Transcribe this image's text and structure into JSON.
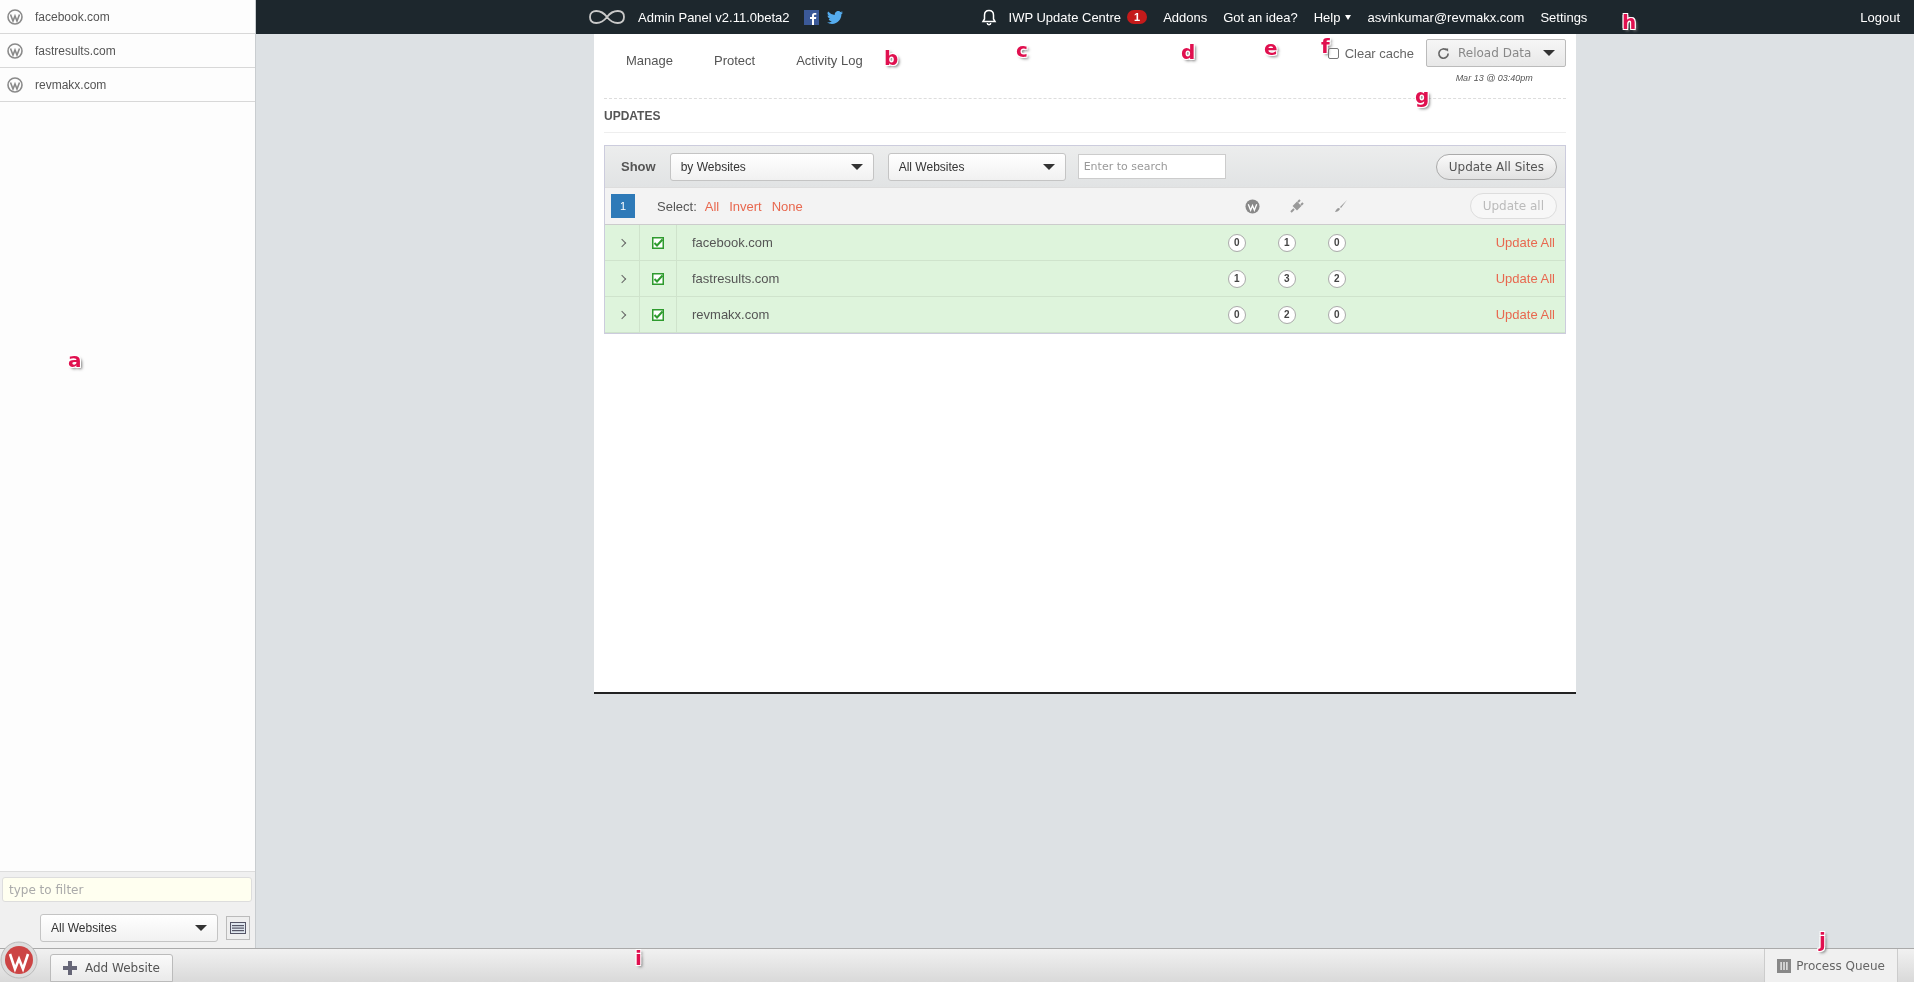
{
  "sidebar": {
    "sites": [
      {
        "name": "facebook.com"
      },
      {
        "name": "fastresults.com"
      },
      {
        "name": "revmakx.com"
      }
    ],
    "filter": {
      "placeholder": "type to filter"
    },
    "group_select": "All Websites"
  },
  "top_bar": {
    "title": "Admin Panel v2.11.0beta2",
    "nav": [
      {
        "label": "IWP Update Centre",
        "badge": "1",
        "dropdown": false
      },
      {
        "label": "Addons",
        "dropdown": false
      },
      {
        "label": "Got an idea?",
        "dropdown": false
      },
      {
        "label": "Help",
        "dropdown": true
      },
      {
        "label": "asvinkumar@revmakx.com",
        "dropdown": false
      },
      {
        "label": "Settings",
        "dropdown": false
      }
    ],
    "logout": "Logout"
  },
  "tabs": [
    {
      "label": "Manage",
      "selected": false
    },
    {
      "label": "Protect",
      "selected": false
    },
    {
      "label": "Activity Log",
      "selected": false
    }
  ],
  "clear_cache": {
    "label": "Clear cache",
    "checked": false
  },
  "reload": {
    "label": "Reload Data",
    "timestamp": "Mar 13 @ 03:40pm"
  },
  "updates": {
    "heading": "UPDATES",
    "show_label": "Show",
    "view_select": "by Websites",
    "site_select": "All Websites",
    "search": {
      "placeholder": "Enter to search"
    },
    "update_all_sites": "Update All Sites",
    "page": "1",
    "select_label": "Select:",
    "select_links": [
      "All",
      "Invert",
      "None"
    ],
    "update_all": {
      "label": "Update all",
      "disabled": true
    },
    "rows": [
      {
        "site": "facebook.com",
        "checked": true,
        "counts": [
          "0",
          "1",
          "0"
        ],
        "action": "Update All"
      },
      {
        "site": "fastresults.com",
        "checked": true,
        "counts": [
          "1",
          "3",
          "2"
        ],
        "action": "Update All"
      },
      {
        "site": "revmakx.com",
        "checked": true,
        "counts": [
          "0",
          "2",
          "0"
        ],
        "action": "Update All"
      }
    ]
  },
  "bottom_bar": {
    "add_website": "Add Website",
    "process_queue": "Process Queue"
  },
  "annotations": [
    {
      "label": "a"
    },
    {
      "label": "b"
    },
    {
      "label": "c"
    },
    {
      "label": "d"
    },
    {
      "label": "e"
    },
    {
      "label": "f"
    },
    {
      "label": "g"
    },
    {
      "label": "h"
    },
    {
      "label": "i"
    },
    {
      "label": "j"
    }
  ]
}
